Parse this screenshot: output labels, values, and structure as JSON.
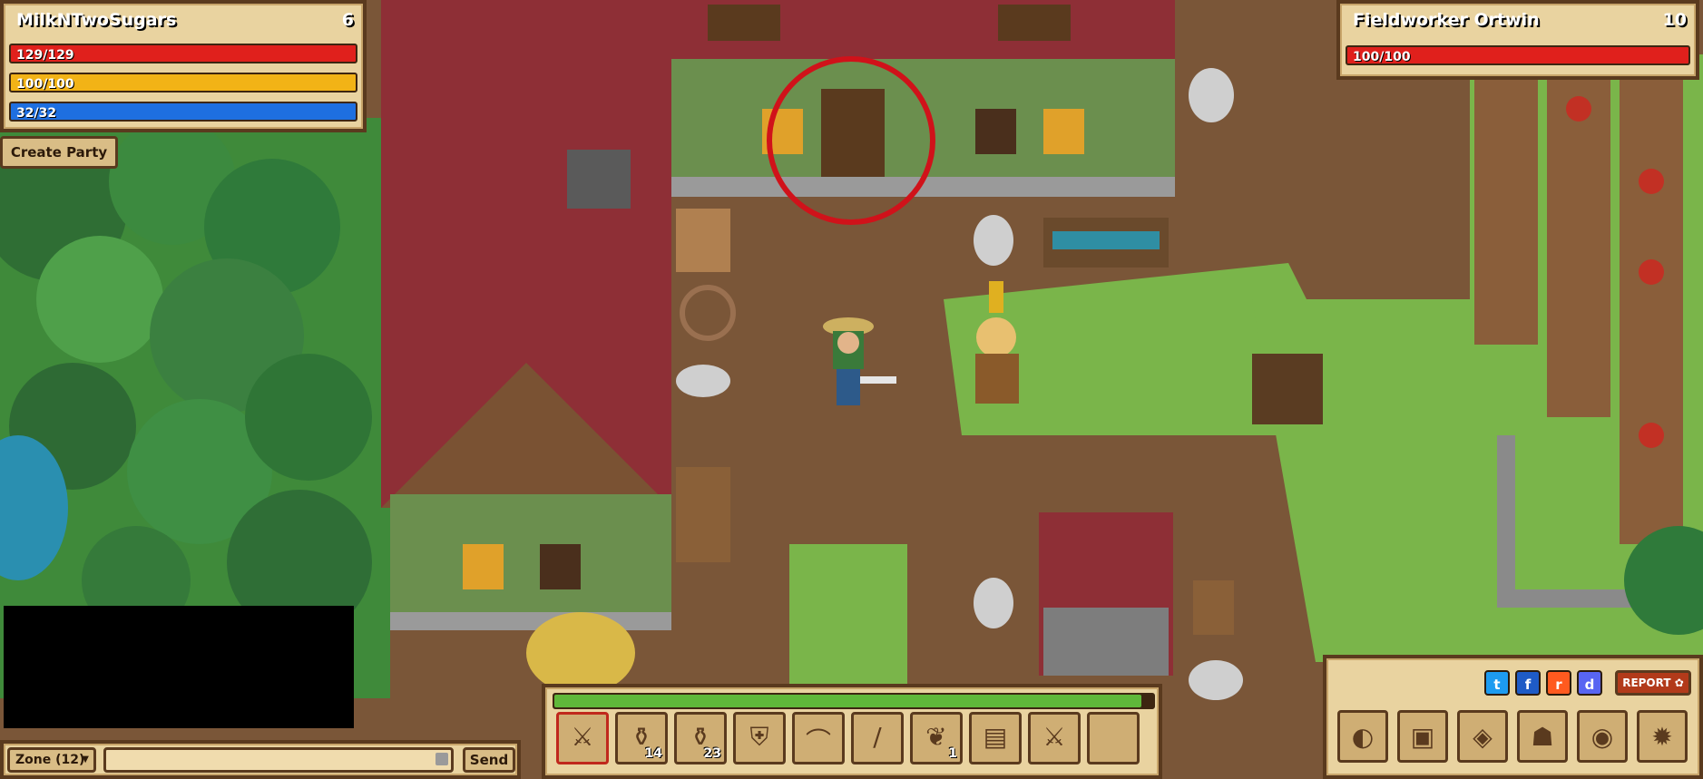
{
  "player": {
    "name": "MilkNTwoSugars",
    "level": "6",
    "health": "129/129",
    "health_fill": 1.0,
    "stamina": "100/100",
    "stamina_fill": 1.0,
    "mana": "32/32",
    "mana_fill": 1.0
  },
  "party": {
    "create_label": "Create Party"
  },
  "target": {
    "name": "Fieldworker Ortwin",
    "level": "10",
    "health": "100/100",
    "health_fill": 1.0
  },
  "chat": {
    "channel": "Zone (12)",
    "input_value": "",
    "send_label": "Send"
  },
  "hotbar": {
    "xp_fill": 0.98,
    "slots": [
      {
        "icon": "sword-icon",
        "count": ""
      },
      {
        "icon": "health-potion-icon",
        "count": "14"
      },
      {
        "icon": "red-potion-icon",
        "count": "23"
      },
      {
        "icon": "armor-icon",
        "count": ""
      },
      {
        "icon": "boots-icon",
        "count": ""
      },
      {
        "icon": "club-icon",
        "count": ""
      },
      {
        "icon": "herb-icon",
        "count": "1"
      },
      {
        "icon": "map-scroll-icon",
        "count": ""
      },
      {
        "icon": "sword-icon",
        "count": ""
      },
      {
        "icon": "",
        "count": ""
      }
    ]
  },
  "social": {
    "report_label": "REPORT"
  },
  "menu": {
    "items": [
      "inventory-icon",
      "quest-book-icon",
      "world-map-icon",
      "character-icon",
      "gold-coins-icon",
      "settings-icon"
    ]
  },
  "colors": {
    "health": "#e0201c",
    "stamina": "#f2b316",
    "mana": "#1e6fe0",
    "highlight_circle": "#d0121a"
  }
}
